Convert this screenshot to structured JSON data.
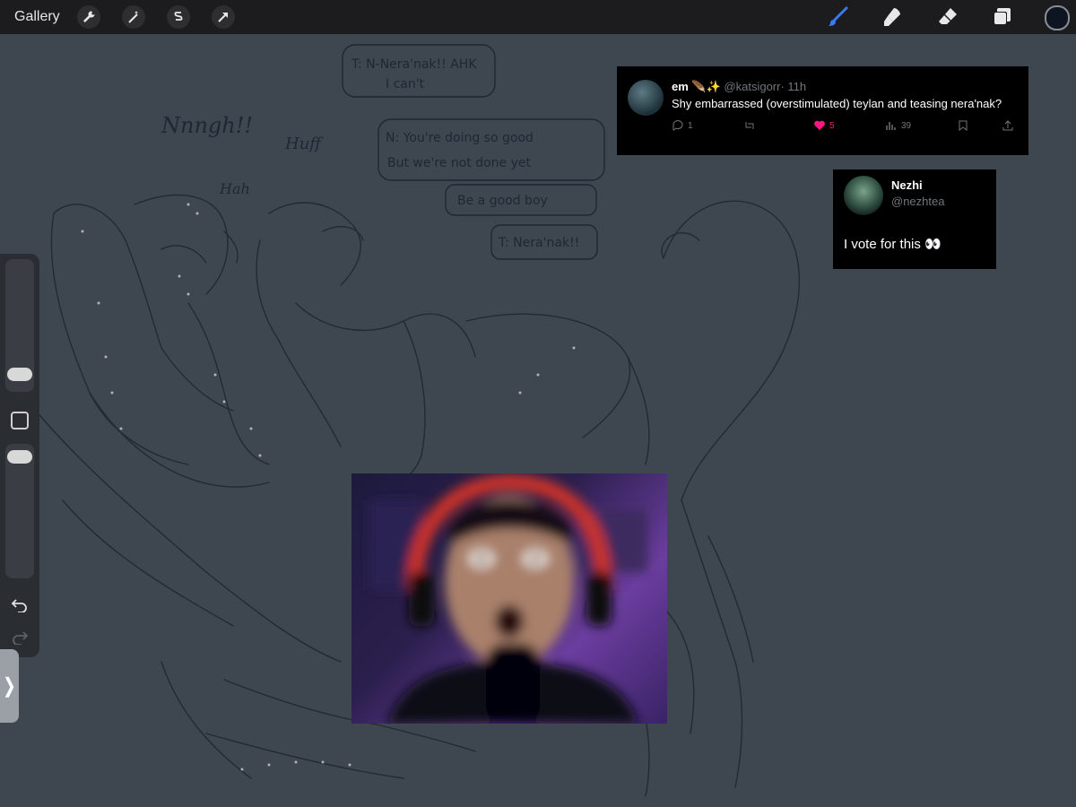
{
  "toolbar": {
    "gallery_label": "Gallery",
    "left_tools": [
      "wrench-icon",
      "magic-wand-icon",
      "selection-icon",
      "transform-icon"
    ],
    "right_tools": [
      "brush-icon",
      "smudge-icon",
      "eraser-icon",
      "layers-icon"
    ],
    "active_tool": "brush",
    "accent_color": "#3a7bf5",
    "current_color": "#0c1520"
  },
  "sidebar": {
    "brush_size_level": 0.6,
    "opacity_level": 0.95
  },
  "sketch": {
    "text_nnngh": "Nnngh!!",
    "text_huff": "Huff",
    "text_hah": "Hah",
    "bubble1_line1": "T: N-Nera'nak!! AHK",
    "bubble1_line2": "I can't",
    "bubble2_line1": "N: You're doing so good",
    "bubble2_line2": "But we're not done yet",
    "bubble3": "Be a good boy",
    "bubble4": "T: Nera'nak!!"
  },
  "tweet1": {
    "name": "em 🪶✨",
    "handle": "@katsigorr",
    "time": "· 11h",
    "text": "Shy embarrassed (overstimulated) teylan and teasing nera'nak?",
    "replies": "1",
    "likes": "5",
    "views": "39"
  },
  "tweet2": {
    "name": "Nezhi",
    "handle": "@nezhtea",
    "text": "I vote for this 👀"
  },
  "webcam": {
    "description_icon": "reaction-face-icon"
  }
}
